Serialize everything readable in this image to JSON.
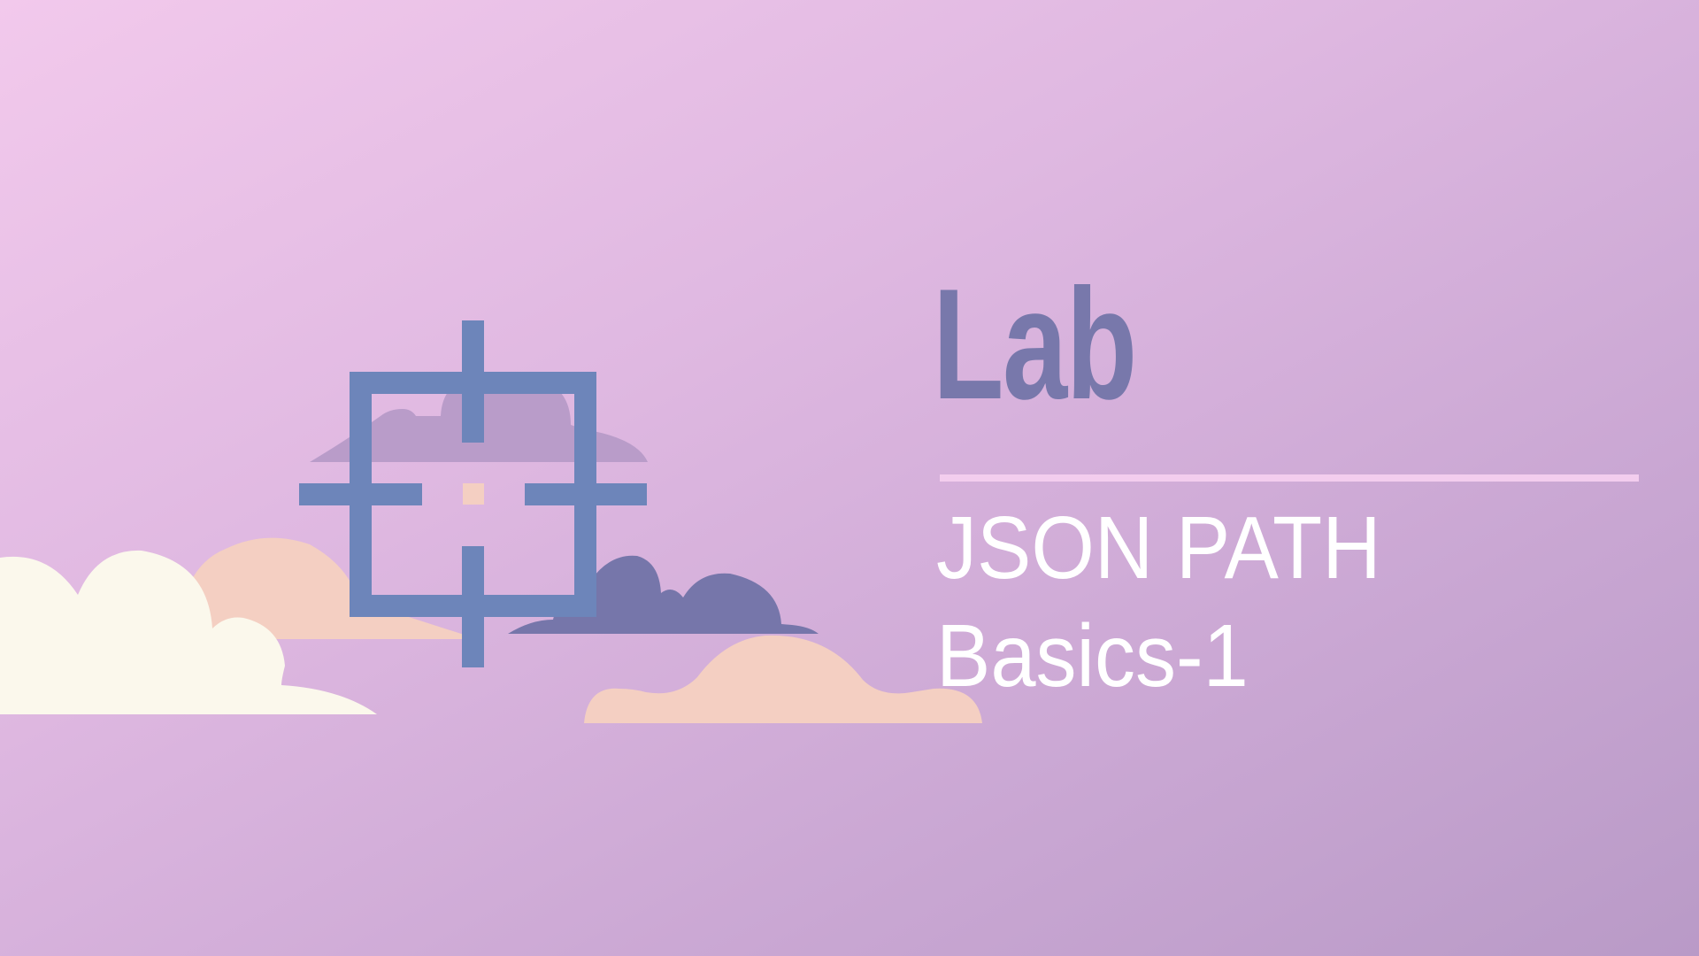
{
  "title": {
    "kicker": "Lab",
    "topic_line1": "JSON PATH",
    "topic_line2": "Basics-1"
  },
  "colors": {
    "kicker_text": "#7878ab",
    "topic_text": "#ffffff",
    "divider": "#f3cdee",
    "crosshair": "#6d85ba",
    "cloud_cream": "#fbf8ec",
    "cloud_peach": "#f4cfc2",
    "cloud_purple": "#7676aa",
    "cloud_lilac": "#b99cc9"
  },
  "icons": [
    "crosshair-icon",
    "cloud-cream",
    "cloud-peach-back",
    "cloud-peach-front",
    "cloud-purple",
    "cloud-lilac"
  ]
}
